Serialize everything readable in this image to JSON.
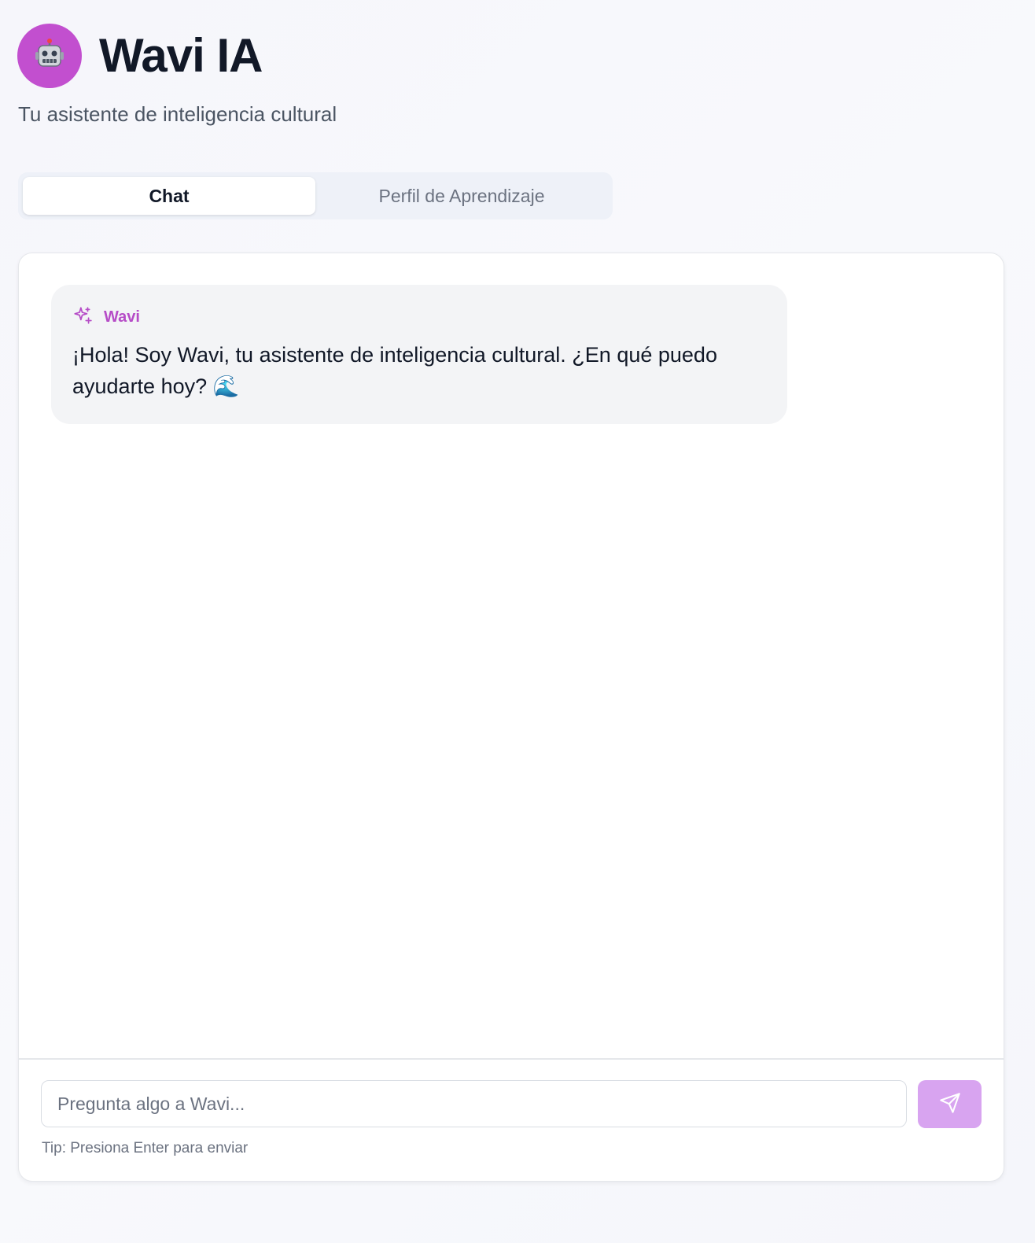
{
  "header": {
    "avatar_icon": "robot-face-icon",
    "title": "Wavi IA",
    "subtitle": "Tu asistente de inteligencia cultural"
  },
  "tabs": [
    {
      "label": "Chat",
      "active": true
    },
    {
      "label": "Perfil de Aprendizaje",
      "active": false
    }
  ],
  "messages": [
    {
      "sender": "Wavi",
      "sender_icon": "sparkles-icon",
      "text": "¡Hola! Soy Wavi, tu asistente de inteligencia cultural. ¿En qué puedo ayudarte hoy? 🌊"
    }
  ],
  "composer": {
    "placeholder": "Pregunta algo a Wavi...",
    "value": "",
    "send_icon": "send-icon",
    "tip": "Tip: Presiona Enter para enviar"
  },
  "colors": {
    "accent": "#b64cc7",
    "avatar_bg": "#c24fcf",
    "send_button": "#d8a4f0"
  }
}
